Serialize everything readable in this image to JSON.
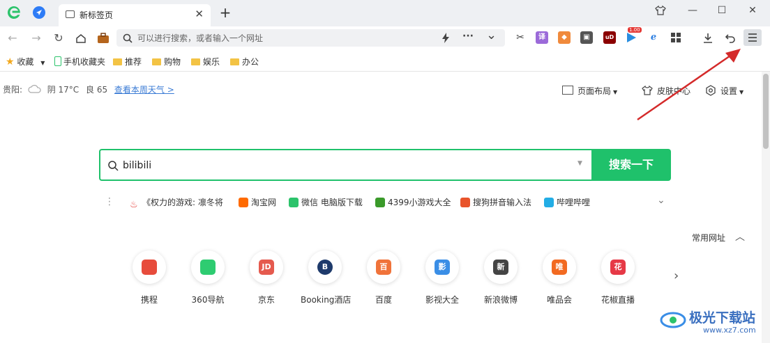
{
  "tab": {
    "title": "新标签页",
    "close": "✕"
  },
  "window": {
    "new_tab": "+",
    "minimize": "—",
    "maximize": "☐",
    "close": "✕"
  },
  "addressbar": {
    "placeholder": "可以进行搜索，或者输入一个网址",
    "more": "···",
    "dropdown": "⌄"
  },
  "extensions": {
    "ublock_label": "uD",
    "video_badge": "1.00"
  },
  "bookmarks": {
    "favorites": "收藏",
    "items": [
      "手机收藏夹",
      "推荐",
      "购物",
      "娱乐",
      "办公"
    ]
  },
  "weather": {
    "city": "贵阳:",
    "desc": "阴 17°C",
    "aqi": "良 65",
    "link": "查看本周天气 >"
  },
  "page_controls": {
    "layout": "页面布局",
    "skin": "皮肤中心",
    "settings": "设置"
  },
  "search": {
    "query": "bilibili",
    "button": "搜索一下"
  },
  "hot": [
    "《权力的游戏: 凛冬将",
    "淘宝网",
    "微信 电脑版下载",
    "4399小游戏大全",
    "搜狗拼音输入法",
    "哔哩哔哩"
  ],
  "sites_header": "常用网址",
  "sites": [
    {
      "label": "携程",
      "logo": "",
      "color": "#e74c3c"
    },
    {
      "label": "360导航",
      "logo": "",
      "color": "#2ecc71"
    },
    {
      "label": "京东",
      "logo": "JD",
      "color": "#e55a4e"
    },
    {
      "label": "Booking酒店",
      "logo": "B",
      "color": "#1e3a6b"
    },
    {
      "label": "百度",
      "logo": "百",
      "color": "#f0733a"
    },
    {
      "label": "影视大全",
      "logo": "影",
      "color": "#3a8ee6"
    },
    {
      "label": "新浪微博",
      "logo": "新",
      "color": "#444444"
    },
    {
      "label": "唯品会",
      "logo": "唯",
      "color": "#f26a21"
    },
    {
      "label": "花椒直播",
      "logo": "花",
      "color": "#e63946"
    }
  ],
  "watermark": {
    "name": "极光下载站",
    "url": "www.xz7.com"
  },
  "colors": {
    "accent": "#1fc16b",
    "annotation": "#d42a2a",
    "link": "#3a7bd5"
  }
}
